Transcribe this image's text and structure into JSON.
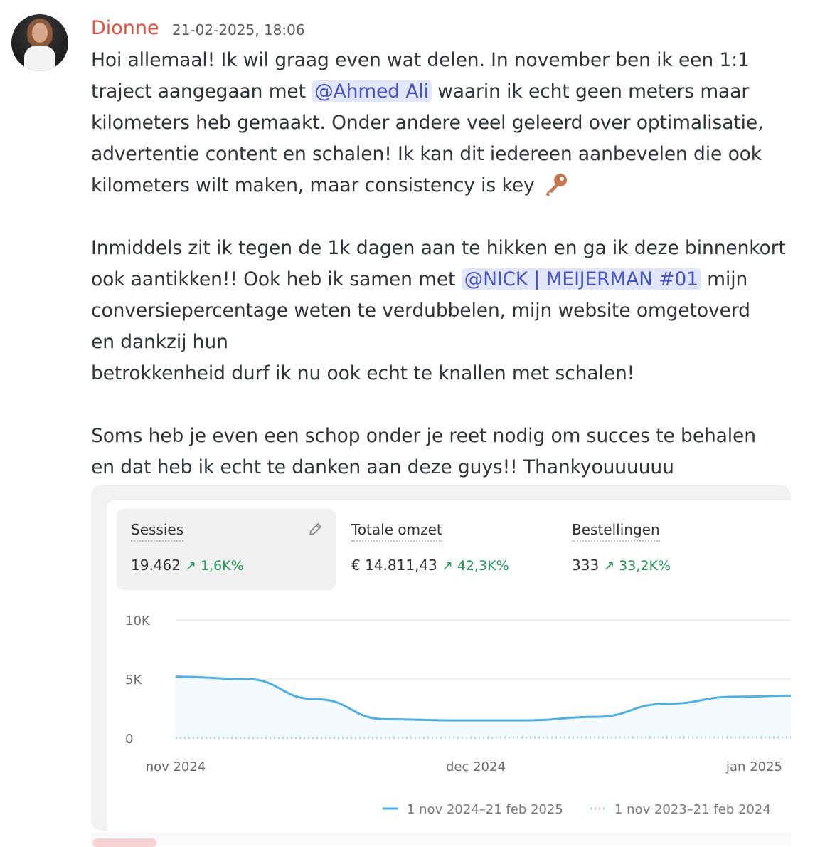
{
  "message": {
    "author": "Dionne",
    "timestamp": "21-02-2025, 18:06",
    "line1": "Hoi allemaal! Ik wil graag even wat delen. In november ben ik een 1:1",
    "line2_pre": "traject aangegaan met ",
    "mention1": "@Ahmed Ali",
    "line2_post": " waarin ik echt geen meters maar",
    "line3": "kilometers heb gemaakt. Onder andere veel geleerd over optimalisatie,",
    "line4": "advertentie content en schalen! Ik kan dit iedereen aanbevelen die ook",
    "line5": "kilometers wilt maken, maar consistency is key ",
    "emoji_name": "key-icon",
    "line6": "Inmiddels zit ik tegen de 1k dagen aan te hikken en ga ik deze binnenkort",
    "line7_pre": "ook aantikken!! Ook heb ik samen met ",
    "mention2": "@NICK | MEIJERMAN #01",
    "line7_post": " mijn",
    "line8": "conversiepercentage weten te verdubbelen, mijn website omgetoverd",
    "line9": "en dankzij hun",
    "line10": "betrokkenheid durf ik nu ook echt te knallen met schalen!",
    "line11": "Soms heb je even een schop onder je reet nodig om succes te behalen",
    "line12": "en dat heb ik echt te danken aan deze guys!! Thankyouuuuuu"
  },
  "kpis": [
    {
      "label": "Sessies",
      "value": "19.462",
      "delta": "↗ 1,6K%"
    },
    {
      "label": "Totale omzet",
      "value": "€ 14.811,43",
      "delta": "↗ 42,3K%"
    },
    {
      "label": "Bestellingen",
      "value": "333",
      "delta": "↗ 33,2K%"
    }
  ],
  "colors": {
    "current": "#4bb0e8",
    "previous": "#9fd3f1",
    "delta_green": "#1f9a55",
    "mention_bg": "#e2e6fb",
    "mention_fg": "#4752c4",
    "author": "#e5533f"
  },
  "chart_data": {
    "type": "line",
    "y_ticks": [
      "10K",
      "5K",
      "0"
    ],
    "ylim": [
      0,
      10000
    ],
    "x_ticks": [
      "nov 2024",
      "dec 2024",
      "jan 2025"
    ],
    "x_tick_days": [
      0,
      30,
      61
    ],
    "xlim_days": [
      0,
      61.5
    ],
    "series": [
      {
        "name": "1 nov 2024–21 feb 2025",
        "style": "solid",
        "x_days": [
          0,
          7,
          14,
          21,
          28,
          35,
          42,
          49,
          56,
          61.5
        ],
        "values": [
          5200,
          5000,
          3300,
          1600,
          1500,
          1500,
          1800,
          2900,
          3500,
          3600
        ]
      },
      {
        "name": "1 nov 2023–21 feb 2024",
        "style": "dotted",
        "x_days": [
          0,
          61.5
        ],
        "values": [
          20,
          60
        ]
      }
    ],
    "grid": true,
    "legend_position": "bottom-right"
  }
}
